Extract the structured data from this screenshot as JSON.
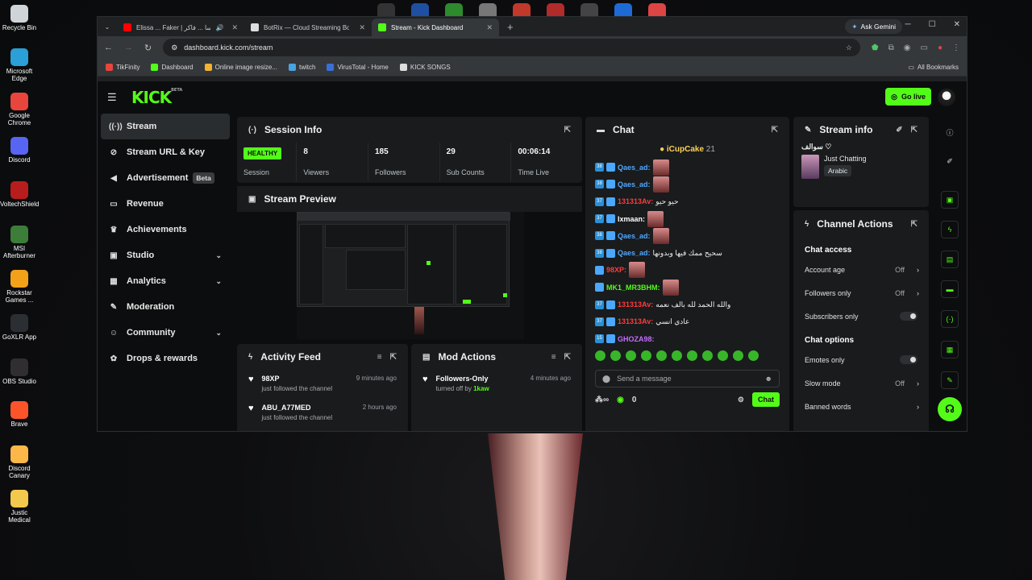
{
  "desktop": {
    "icons": [
      {
        "label": "Recycle Bin",
        "color": "#cfd4d8"
      },
      {
        "label": "Microsoft Edge",
        "color": "#2a9fd8"
      },
      {
        "label": "Google Chrome",
        "color": "#e8453c"
      },
      {
        "label": "Discord",
        "color": "#5865f2"
      },
      {
        "label": "VoltechShield",
        "color": "#b81d1d"
      },
      {
        "label": "MSI Afterburner",
        "color": "#3d7d3a"
      },
      {
        "label": "Rockstar Games ...",
        "color": "#f4a11a"
      },
      {
        "label": "GoXLR App",
        "color": "#2b2f33"
      },
      {
        "label": "OBS Studio",
        "color": "#302e31"
      },
      {
        "label": "Brave",
        "color": "#fb542b"
      },
      {
        "label": "Discord Canary",
        "color": "#fbb848"
      },
      {
        "label": "Justic Medical",
        "color": "#f2c94c"
      }
    ],
    "taskbar_top_colors": [
      "#333",
      "#1f4fa0",
      "#2d8a2d",
      "#777",
      "#c0392b",
      "#b12b2b",
      "#444",
      "#1e6bd6",
      "#d44"
    ]
  },
  "browser": {
    "tabs": [
      {
        "title": "Elissa ... Faker | اليسا ... فاكر",
        "favicon_color": "#ff0000",
        "active": false
      },
      {
        "title": "BotRix — Cloud Streaming Bot",
        "favicon_color": "#dddddd",
        "active": false
      },
      {
        "title": "Stream - Kick Dashboard",
        "favicon_color": "#53fc18",
        "active": true
      }
    ],
    "ask_gemini": "Ask Gemini",
    "url": "dashboard.kick.com/stream",
    "bookmarks": [
      {
        "label": "TikFinity",
        "color": "#e8453c"
      },
      {
        "label": "Dashboard",
        "color": "#53fc18"
      },
      {
        "label": "Online image resize...",
        "color": "#f2b233"
      },
      {
        "label": "twitch",
        "color": "#4aa3df"
      },
      {
        "label": "VirusTotal - Home",
        "color": "#3a6fd8"
      },
      {
        "label": "KICK SONGS",
        "color": "#dddddd"
      }
    ],
    "all_bookmarks": "All Bookmarks"
  },
  "kick": {
    "logo": "KICK",
    "logo_beta": "BETA",
    "go_live": "Go live",
    "sidebar": [
      {
        "label": "Stream",
        "icon": "broadcast-icon",
        "glyph": "((·))",
        "active": true
      },
      {
        "label": "Stream URL & Key",
        "icon": "link-icon",
        "glyph": "⊘"
      },
      {
        "label": "Advertisement",
        "icon": "megaphone-icon",
        "glyph": "◀",
        "badge": "Beta"
      },
      {
        "label": "Revenue",
        "icon": "revenue-icon",
        "glyph": "▭"
      },
      {
        "label": "Achievements",
        "icon": "trophy-icon",
        "glyph": "♛"
      },
      {
        "label": "Studio",
        "icon": "studio-icon",
        "glyph": "▣",
        "chevron": true
      },
      {
        "label": "Analytics",
        "icon": "analytics-icon",
        "glyph": "▦",
        "chevron": true
      },
      {
        "label": "Moderation",
        "icon": "wrench-icon",
        "glyph": "✎"
      },
      {
        "label": "Community",
        "icon": "community-icon",
        "glyph": "☺",
        "chevron": true
      },
      {
        "label": "Drops & rewards",
        "icon": "gift-icon",
        "glyph": "✿"
      }
    ],
    "session": {
      "title": "Session Info",
      "health": "HEALTHY",
      "health_label": "Session",
      "stats": [
        {
          "value": "8",
          "label": "Viewers"
        },
        {
          "value": "185",
          "label": "Followers"
        },
        {
          "value": "29",
          "label": "Sub Counts"
        },
        {
          "value": "00:06:14",
          "label": "Time Live"
        }
      ]
    },
    "preview": {
      "title": "Stream Preview"
    },
    "activity": {
      "title": "Activity Feed",
      "items": [
        {
          "user": "98XP",
          "text": "just followed the channel",
          "time": "9 minutes ago"
        },
        {
          "user": "ABU_A77MED",
          "text": "just followed the channel",
          "time": "2 hours ago"
        }
      ]
    },
    "mod_actions": {
      "title": "Mod Actions",
      "items": [
        {
          "title": "Followers-Only",
          "text_prefix": "turned off by",
          "actor": "1kaw",
          "time": "4 minutes ago"
        }
      ]
    },
    "chat": {
      "title": "Chat",
      "gift": {
        "user": "iCupCake",
        "count": "21"
      },
      "messages": [
        {
          "badge": "38",
          "name": "Qaes_ad:",
          "color": "#4fa8ff",
          "text": "",
          "emote": true
        },
        {
          "badge": "38",
          "name": "Qaes_ad:",
          "color": "#4fa8ff",
          "text": "",
          "emote": true
        },
        {
          "badge": "37",
          "name": "131313Av:",
          "color": "#ff3b3b",
          "text": "حيو حيو",
          "emote": false
        },
        {
          "badge": "37",
          "name": "lxmaan:",
          "color": "#ffffff",
          "text": "",
          "emote": true
        },
        {
          "badge": "38",
          "name": "Qaes_ad:",
          "color": "#4fa8ff",
          "text": "",
          "emote": true
        },
        {
          "badge": "38",
          "name": "Qaes_ad:",
          "color": "#4fa8ff",
          "text": "سحيح ممك فيها وبدونها",
          "emote": false
        },
        {
          "badge": "",
          "name": "98XP:",
          "color": "#ff3b3b",
          "text": "",
          "emote": true
        },
        {
          "badge": "",
          "name": "MK1_MR3BHM:",
          "color": "#53fc18",
          "text": "",
          "emote": true
        },
        {
          "badge": "37",
          "name": "131313Av:",
          "color": "#ff3b3b",
          "text": "والله الحمد لله بالف نعمه",
          "emote": false
        },
        {
          "badge": "37",
          "name": "131313Av:",
          "color": "#ff3b3b",
          "text": "عادي انسي",
          "emote": false
        },
        {
          "badge": "15",
          "name": "GHOZA98:",
          "color": "#c46cff",
          "text": "",
          "emote": false
        }
      ],
      "input_placeholder": "Send a message",
      "viewer_count": "0",
      "send_label": "Chat"
    },
    "stream_info": {
      "title": "Stream info",
      "stream_title": "سوالف ♡",
      "category": "Just Chatting",
      "tag": "Arabic"
    },
    "channel_actions": {
      "title": "Channel Actions",
      "sections": [
        {
          "heading": "Chat access",
          "rows": [
            {
              "label": "Account age",
              "value": "Off",
              "type": "arrow"
            },
            {
              "label": "Followers only",
              "value": "Off",
              "type": "arrow"
            },
            {
              "label": "Subscribers only",
              "value": "",
              "type": "toggle"
            }
          ]
        },
        {
          "heading": "Chat options",
          "rows": [
            {
              "label": "Emotes only",
              "value": "",
              "type": "toggle"
            },
            {
              "label": "Slow mode",
              "value": "Off",
              "type": "arrow"
            },
            {
              "label": "Banned words",
              "value": "",
              "type": "arrow"
            }
          ]
        }
      ]
    }
  }
}
